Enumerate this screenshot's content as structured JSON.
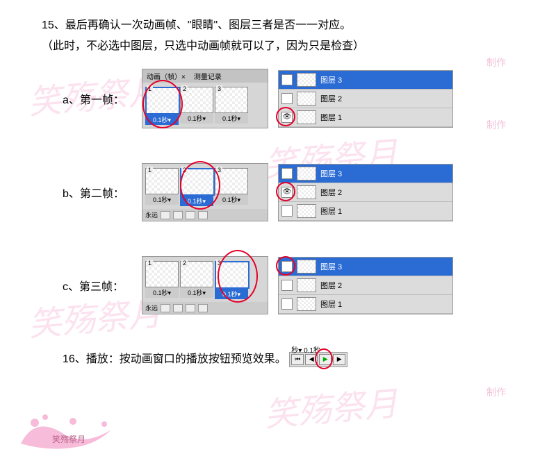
{
  "step15": {
    "line1": "15、最后再确认一次动画帧、\"眼睛\"、图层三者是否一一对应。",
    "line2": "（此时，不必选中图层，只选中动画帧就可以了，因为只是检查）"
  },
  "rows": [
    {
      "label": "a、第一帧："
    },
    {
      "label": "b、第二帧："
    },
    {
      "label": "c、第三帧："
    }
  ],
  "anim": {
    "tab1": "动画（帧）×",
    "tab2": "测量记录",
    "frames": [
      "1",
      "2",
      "3"
    ],
    "time": "0.1秒▾",
    "forever": "永远"
  },
  "layers": {
    "items": [
      "图层 3",
      "图层 2",
      "图层 1"
    ]
  },
  "step16": {
    "text": "16、播放：按动画窗口的播放按钮预览效果。",
    "time_label": "秒▾   0.1秒"
  },
  "watermark": "笑殇祭月",
  "watermark_small": "制作"
}
